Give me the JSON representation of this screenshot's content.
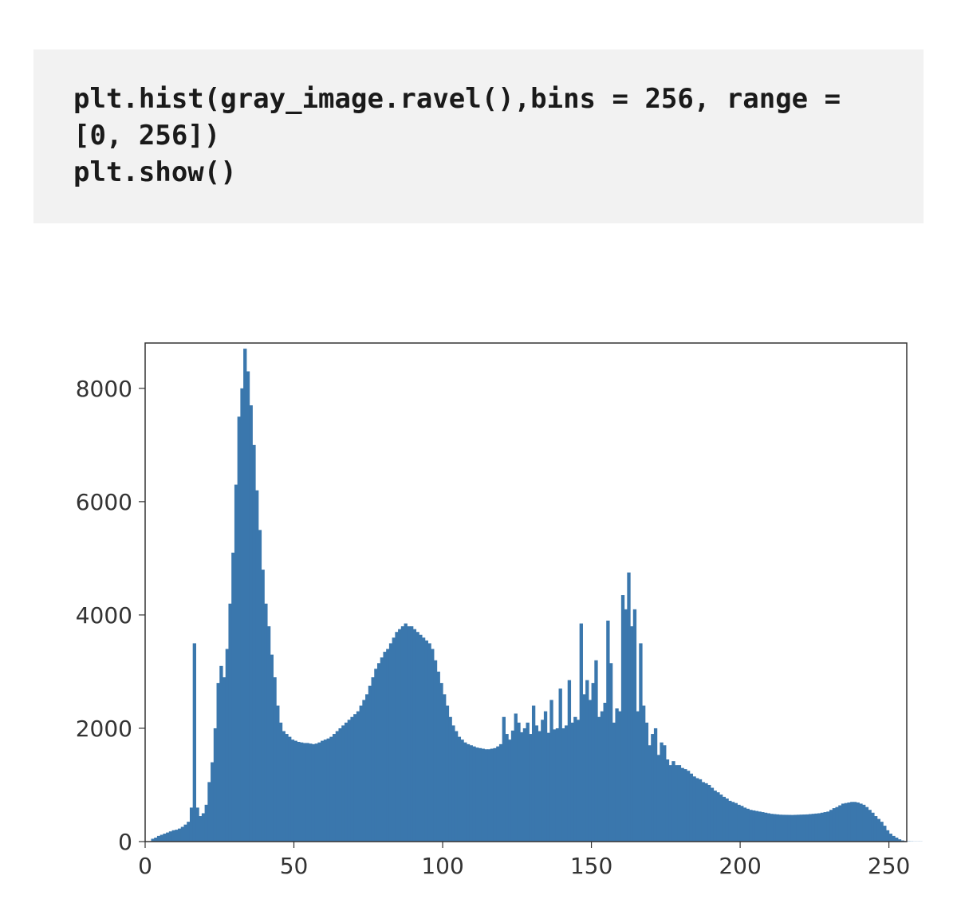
{
  "code": {
    "line1": "plt.hist(gray_image.ravel(),bins = 256, range = [0, 256])",
    "line2": "plt.show()"
  },
  "chart_data": {
    "type": "bar",
    "title": "",
    "xlabel": "",
    "ylabel": "",
    "xlim": [
      0,
      256
    ],
    "ylim": [
      0,
      8800
    ],
    "x_ticks": [
      0,
      50,
      100,
      150,
      200,
      250
    ],
    "y_ticks": [
      0,
      2000,
      4000,
      6000,
      8000
    ],
    "categories_note": "bin index = pixel intensity 0..255",
    "values": [
      0,
      0,
      50,
      70,
      100,
      120,
      140,
      160,
      180,
      200,
      210,
      230,
      260,
      300,
      350,
      600,
      3500,
      600,
      450,
      500,
      650,
      1050,
      1400,
      2000,
      2800,
      3100,
      2900,
      3400,
      4200,
      5100,
      6300,
      7500,
      8000,
      8700,
      8300,
      7700,
      7000,
      6200,
      5500,
      4800,
      4200,
      3800,
      3300,
      2900,
      2400,
      2100,
      1950,
      1900,
      1850,
      1800,
      1780,
      1760,
      1750,
      1740,
      1740,
      1730,
      1720,
      1730,
      1750,
      1780,
      1800,
      1820,
      1850,
      1900,
      1950,
      2000,
      2050,
      2100,
      2150,
      2200,
      2250,
      2300,
      2400,
      2500,
      2600,
      2750,
      2900,
      3050,
      3150,
      3250,
      3350,
      3400,
      3500,
      3600,
      3700,
      3750,
      3800,
      3850,
      3800,
      3800,
      3750,
      3700,
      3650,
      3600,
      3550,
      3500,
      3400,
      3200,
      3000,
      2800,
      2600,
      2400,
      2200,
      2050,
      1950,
      1850,
      1800,
      1750,
      1720,
      1700,
      1680,
      1660,
      1650,
      1640,
      1630,
      1630,
      1640,
      1650,
      1680,
      1720,
      2200,
      1900,
      1800,
      1960,
      2260,
      2100,
      1930,
      2000,
      2100,
      1900,
      2400,
      2050,
      1950,
      2150,
      2300,
      1920,
      2500,
      1980,
      2000,
      2700,
      2000,
      2050,
      2850,
      2100,
      2200,
      2150,
      3850,
      2600,
      2850,
      2500,
      2800,
      3200,
      2200,
      2300,
      2450,
      3900,
      3150,
      2100,
      2350,
      2300,
      4350,
      4100,
      4750,
      3800,
      4100,
      2300,
      3500,
      2400,
      2100,
      1700,
      1900,
      2000,
      1530,
      1750,
      1700,
      1450,
      1350,
      1420,
      1350,
      1350,
      1300,
      1280,
      1250,
      1200,
      1150,
      1120,
      1100,
      1050,
      1030,
      1000,
      950,
      900,
      870,
      830,
      790,
      760,
      720,
      700,
      680,
      650,
      630,
      600,
      580,
      560,
      550,
      540,
      530,
      520,
      510,
      500,
      490,
      485,
      480,
      475,
      473,
      472,
      471,
      470,
      472,
      474,
      476,
      478,
      480,
      485,
      490,
      495,
      500,
      510,
      520,
      530,
      560,
      590,
      610,
      640,
      670,
      680,
      690,
      700,
      700,
      690,
      670,
      650,
      610,
      560,
      510,
      450,
      400,
      350,
      280,
      200,
      140,
      100,
      70,
      40,
      20,
      10,
      5,
      3,
      2,
      2,
      2,
      1,
      1,
      1,
      1,
      0,
      0,
      0,
      0,
      0,
      0,
      0,
      0,
      0,
      0,
      0
    ]
  },
  "colors": {
    "bar": "#3a77ad",
    "code_bg": "#f2f2f2"
  }
}
